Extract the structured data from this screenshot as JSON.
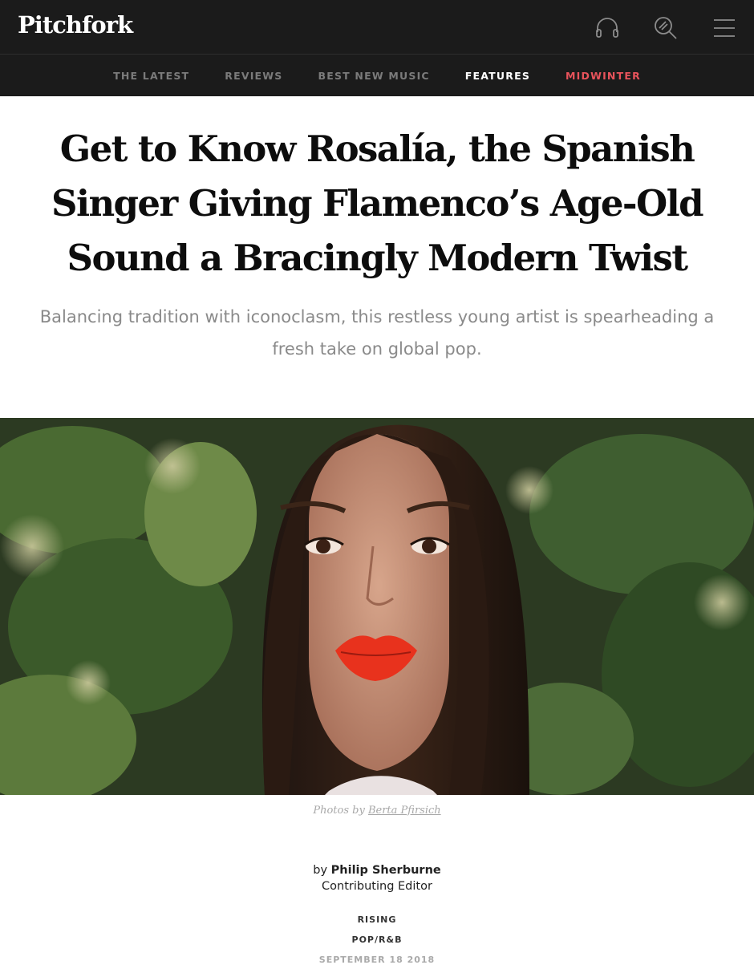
{
  "header": {
    "logo": "Pitchfork",
    "icons": [
      "headphones-icon",
      "search-icon",
      "menu-icon"
    ]
  },
  "nav": {
    "items": [
      "THE LATEST",
      "REVIEWS",
      "BEST NEW MUSIC",
      "FEATURES",
      "MIDWINTER"
    ],
    "active": "FEATURES",
    "accent_item": "MIDWINTER",
    "accent_color": "#e8535b"
  },
  "article": {
    "title": "Get to Know Rosalía, the Spanish Singer Giving Flamenco’s Age-Old Sound a Bracingly Modern Twist",
    "dek": "Balancing tradition with iconoclasm, this restless young artist is spearheading a fresh take on global pop.",
    "photo_credit_prefix": "Photos by",
    "photo_credit_name": "Berta Pfirsich",
    "byline_prefix": "by",
    "author": "Philip Sherburne",
    "author_role": "Contributing Editor",
    "tags": [
      "RISING",
      "POP/R&B"
    ],
    "date": "SEPTEMBER 18 2018"
  },
  "colors": {
    "header_bg": "#1b1b1b",
    "lip_red": "#e8321d"
  }
}
